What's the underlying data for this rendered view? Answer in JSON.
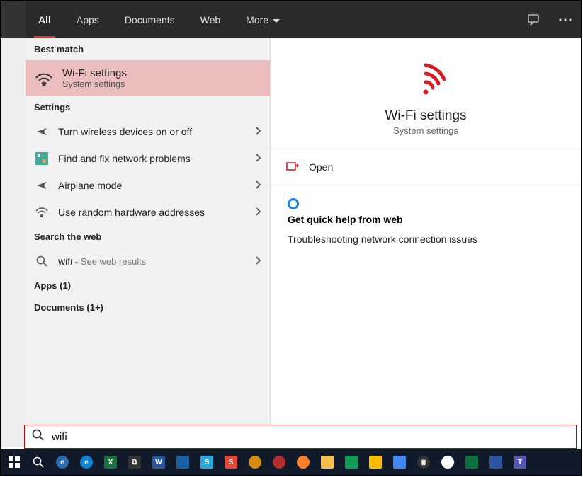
{
  "tabs": {
    "all": "All",
    "apps": "Apps",
    "documents": "Documents",
    "web": "Web",
    "more": "More"
  },
  "sections": {
    "best_match": "Best match",
    "settings": "Settings",
    "search_web": "Search the web",
    "apps_count": "Apps (1)",
    "docs_count": "Documents (1+)"
  },
  "best_match": {
    "title": "Wi-Fi settings",
    "subtitle": "System settings"
  },
  "settings_items": [
    {
      "label": "Turn wireless devices on or off"
    },
    {
      "label": "Find and fix network problems"
    },
    {
      "label": "Airplane mode"
    },
    {
      "label": "Use random hardware addresses"
    }
  ],
  "web_item": {
    "prefix": "wifi",
    "suffix": " - See web results"
  },
  "preview": {
    "title": "Wi-Fi settings",
    "subtitle": "System settings",
    "open": "Open",
    "help_title": "Get quick help from web",
    "help_link": "Troubleshooting network connection issues"
  },
  "search": {
    "value": "wifi"
  }
}
